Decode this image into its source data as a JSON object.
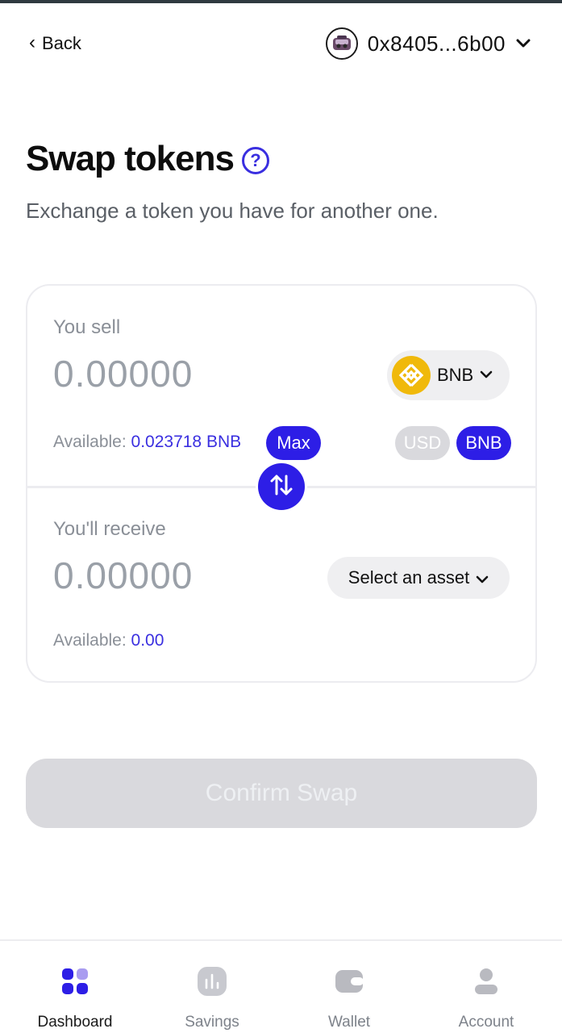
{
  "header": {
    "back_label": "Back",
    "address": "0x8405...6b00"
  },
  "page": {
    "title": "Swap tokens",
    "subtitle": "Exchange a token you have for another one."
  },
  "sell": {
    "label": "You sell",
    "amount": "0.00000",
    "token": "BNB",
    "available_prefix": "Available: ",
    "available_value": "0.023718 BNB",
    "max_label": "Max",
    "units": [
      "USD",
      "BNB"
    ],
    "selected_unit": "BNB"
  },
  "receive": {
    "label": "You'll receive",
    "amount": "0.00000",
    "asset_placeholder": "Select an asset",
    "available_prefix": "Available: ",
    "available_value": "0.00"
  },
  "confirm_label": "Confirm Swap",
  "nav": {
    "items": [
      {
        "label": "Dashboard",
        "icon": "dashboard-icon",
        "active": true
      },
      {
        "label": "Savings",
        "icon": "savings-icon",
        "active": false
      },
      {
        "label": "Wallet",
        "icon": "wallet-icon",
        "active": false
      },
      {
        "label": "Account",
        "icon": "account-icon",
        "active": false
      }
    ]
  },
  "colors": {
    "accent": "#2d1ee6",
    "disabled": "#d9d9dd",
    "bnb": "#f0b90b"
  }
}
